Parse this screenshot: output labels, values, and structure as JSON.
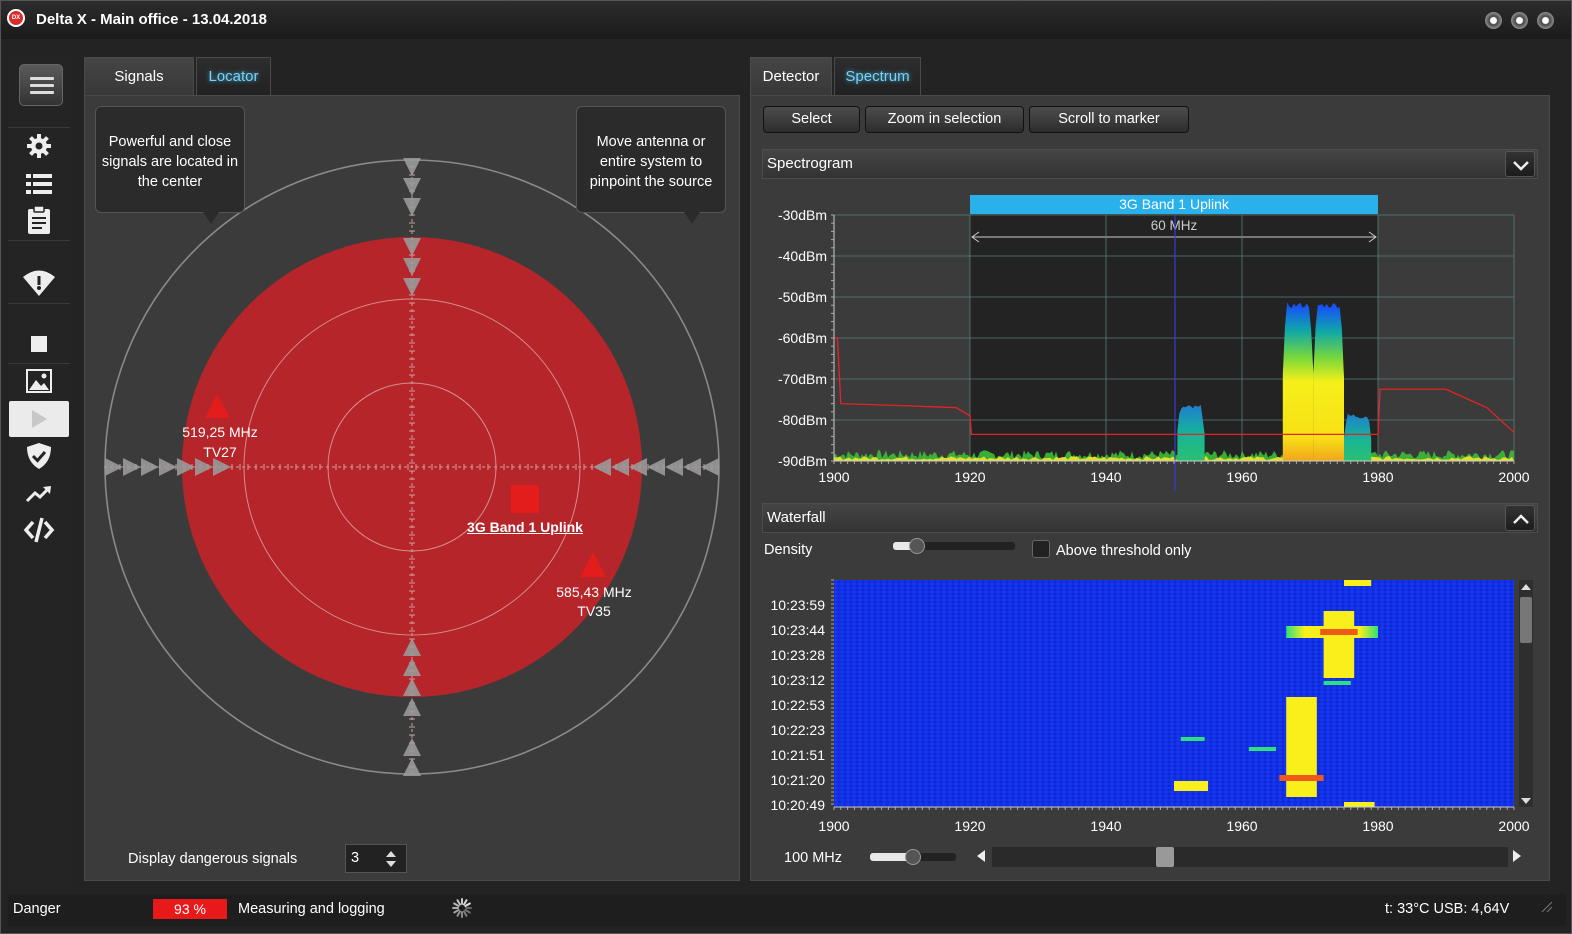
{
  "window": {
    "title": "Delta X - Main office - 13.04.2018",
    "logo_text": "DX"
  },
  "left_panel": {
    "tabs": [
      {
        "label": "Signals",
        "active": false
      },
      {
        "label": "Locator",
        "active": true
      }
    ],
    "callout_left": "Powerful and close signals are located in the center",
    "callout_right": "Move antenna or entire system to pinpoint the source",
    "signals": [
      {
        "freq": "519,25 MHz",
        "channel": "TV27",
        "marker": "triangle"
      },
      {
        "freq": "585,43 MHz",
        "channel": "TV35",
        "marker": "triangle"
      },
      {
        "freq": "",
        "channel": "3G Band 1 Uplink",
        "marker": "square"
      }
    ],
    "display_dangerous_label": "Display dangerous signals",
    "display_dangerous_value": "3"
  },
  "right_panel": {
    "tabs": [
      {
        "label": "Detector",
        "active": false
      },
      {
        "label": "Spectrum",
        "active": true
      }
    ],
    "toolbar": {
      "select": "Select",
      "zoom": "Zoom in selection",
      "scroll": "Scroll to marker"
    },
    "spectrogram": {
      "title": "Spectrogram",
      "band_label": "3G Band 1 Uplink",
      "band_width_label": "60 MHz",
      "y_ticks": [
        "-30dBm",
        "-40dBm",
        "-50dBm",
        "-60dBm",
        "-70dBm",
        "-80dBm",
        "-90dBm"
      ],
      "x_ticks": [
        "1900",
        "1920",
        "1940",
        "1960",
        "1980",
        "2000"
      ]
    },
    "waterfall": {
      "title": "Waterfall",
      "density_label": "Density",
      "density_value": 0.2,
      "threshold_label": "Above threshold only",
      "threshold_checked": false,
      "time_ticks": [
        "10:23:59",
        "10:23:44",
        "10:23:28",
        "10:23:12",
        "10:22:53",
        "10:22:23",
        "10:21:51",
        "10:21:20",
        "10:20:49"
      ],
      "x_ticks": [
        "1900",
        "1920",
        "1940",
        "1960",
        "1980",
        "2000"
      ],
      "span_label": "100 MHz",
      "span_value": 0.5,
      "scroll_value": 0.33
    }
  },
  "chart_data": {
    "type": "line",
    "title": "Spectrogram",
    "xlabel": "",
    "ylabel": "",
    "xlim": [
      1900,
      2000
    ],
    "ylim": [
      -90,
      -30
    ],
    "x_ticks": [
      1900,
      1920,
      1940,
      1960,
      1980,
      2000
    ],
    "y_ticks": [
      -30,
      -40,
      -50,
      -60,
      -70,
      -80,
      -90
    ],
    "highlight_band": {
      "label": "3G Band 1 Uplink",
      "from": 1920,
      "to": 1980,
      "width_label": "60 MHz"
    },
    "series": [
      {
        "x": [
          1900,
          1900.5,
          1901,
          1910,
          1918,
          1920,
          1920.2,
          1979.8,
          1980,
          1980.3,
          1990,
          1996,
          2000
        ],
        "y": [
          -60,
          -60,
          -76,
          -76.5,
          -77,
          -79,
          -83.5,
          -83.5,
          -83.5,
          -72.5,
          -72.5,
          -77,
          -83
        ]
      }
    ],
    "signal_peaks": [
      {
        "from": 1950.5,
        "to": 1954.5,
        "peak": -77
      },
      {
        "from": 1966,
        "to": 1970.5,
        "peak": -52
      },
      {
        "from": 1970.5,
        "to": 1975,
        "peak": -52
      },
      {
        "from": 1975,
        "to": 1979,
        "peak": -79
      }
    ]
  },
  "status": {
    "state": "Danger",
    "level": "93 %",
    "level_value": 0.93,
    "message": "Measuring and logging",
    "telemetry": "t: 33°C  USB: 4,64V"
  },
  "colors": {
    "accent": "#3fb9ef",
    "danger": "#e8191a",
    "locator_zone": "#b5252a",
    "band_highlight": "#2ab0ea"
  }
}
